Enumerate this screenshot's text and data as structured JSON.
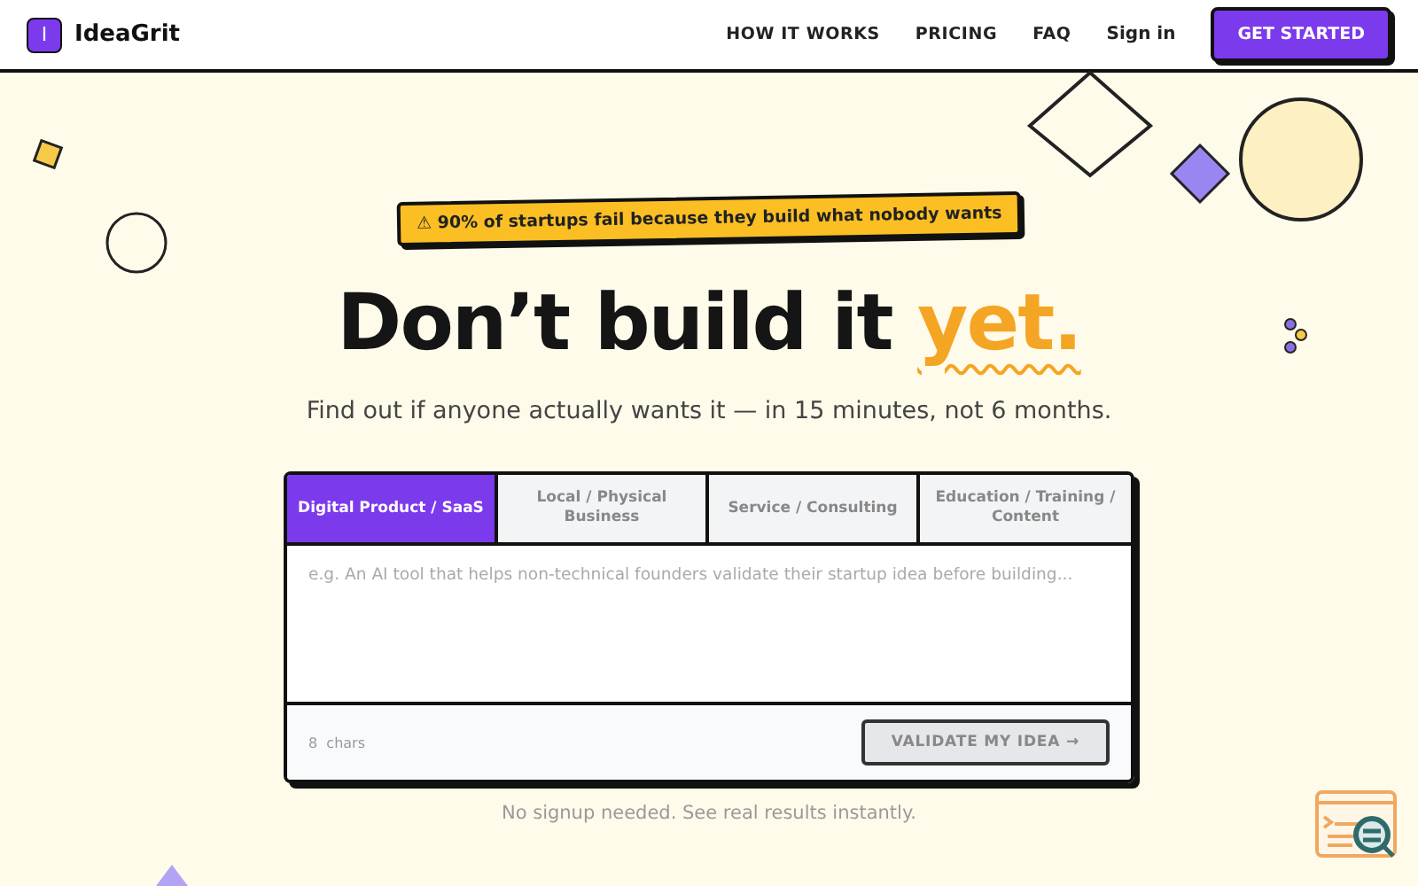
{
  "header": {
    "logo_letter": "I",
    "brand": "IdeaGrit",
    "nav": [
      {
        "label": "HOW IT WORKS",
        "kind": "link"
      },
      {
        "label": "PRICING",
        "kind": "link"
      },
      {
        "label": "FAQ",
        "kind": "link"
      },
      {
        "label": "Sign in",
        "kind": "plain"
      },
      {
        "label": "GET STARTED",
        "kind": "cta"
      }
    ]
  },
  "hero": {
    "badge": "⚠ 90% of startups fail because they build what nobody wants",
    "headline": "Don’t build it ",
    "headline_accent": "yet.",
    "subtitle": "Find out if anyone actually wants it — in 15 minutes, not 6 months."
  },
  "idea_form": {
    "tabs": [
      {
        "label": "Digital Product / SaaS",
        "selected": true
      },
      {
        "label": "Local / Physical Business",
        "selected": false
      },
      {
        "label": "Service / Consulting",
        "selected": false
      },
      {
        "label": "Education / Training / Content",
        "selected": false
      }
    ],
    "placeholder": "e.g. An AI tool that helps non-technical founders validate their startup idea before building...",
    "char_count": "8  chars",
    "submit": {
      "label": "VALIDATE MY IDEA →",
      "disabled": true
    }
  },
  "note": "No signup needed. See real results instantly."
}
